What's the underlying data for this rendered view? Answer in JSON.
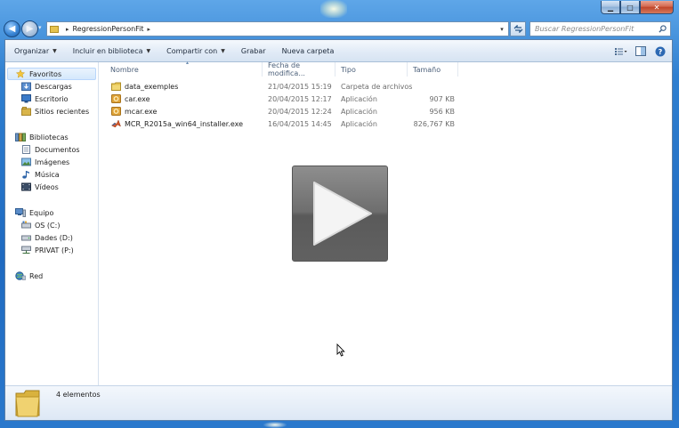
{
  "window": {
    "caption_buttons": {
      "minimize": "▁",
      "maximize": "□",
      "close": "✕"
    }
  },
  "address_bar": {
    "path_separator": "▸",
    "segments": [
      "RegressionPersonFit"
    ],
    "trailing_separator": "▸"
  },
  "search": {
    "placeholder": "Buscar RegressionPersonFit"
  },
  "toolbar": {
    "organize": "Organizar",
    "include_in_library": "Incluir en biblioteca",
    "share_with": "Compartir con",
    "burn": "Grabar",
    "new_folder": "Nueva carpeta"
  },
  "navigation": {
    "favorites": {
      "label": "Favoritos",
      "items": [
        "Descargas",
        "Escritorio",
        "Sitios recientes"
      ]
    },
    "libraries": {
      "label": "Bibliotecas",
      "items": [
        "Documentos",
        "Imágenes",
        "Música",
        "Vídeos"
      ]
    },
    "computer": {
      "label": "Equipo",
      "items": [
        "OS (C:)",
        "Dades (D:)",
        "PRIVAT (P:)"
      ]
    },
    "network": {
      "label": "Red"
    }
  },
  "columns": {
    "name": "Nombre",
    "date": "Fecha de modifica...",
    "type": "Tipo",
    "size": "Tamaño"
  },
  "files": [
    {
      "name": "data_exemples",
      "date": "21/04/2015 15:19",
      "type": "Carpeta de archivos",
      "size": "",
      "icon": "folder-icon"
    },
    {
      "name": "car.exe",
      "date": "20/04/2015 12:17",
      "type": "Aplicación",
      "size": "907 KB",
      "icon": "exe-gear-icon"
    },
    {
      "name": "mcar.exe",
      "date": "20/04/2015 12:24",
      "type": "Aplicación",
      "size": "956 KB",
      "icon": "exe-gear-icon"
    },
    {
      "name": "MCR_R2015a_win64_installer.exe",
      "date": "16/04/2015 14:45",
      "type": "Aplicación",
      "size": "826,767 KB",
      "icon": "matlab-icon"
    }
  ],
  "details": {
    "item_count": "4 elementos"
  },
  "colors": {
    "frame_blue": "#2f7fd0",
    "selection": "#d4e8fc",
    "folder_yellow": "#e6c34f"
  }
}
